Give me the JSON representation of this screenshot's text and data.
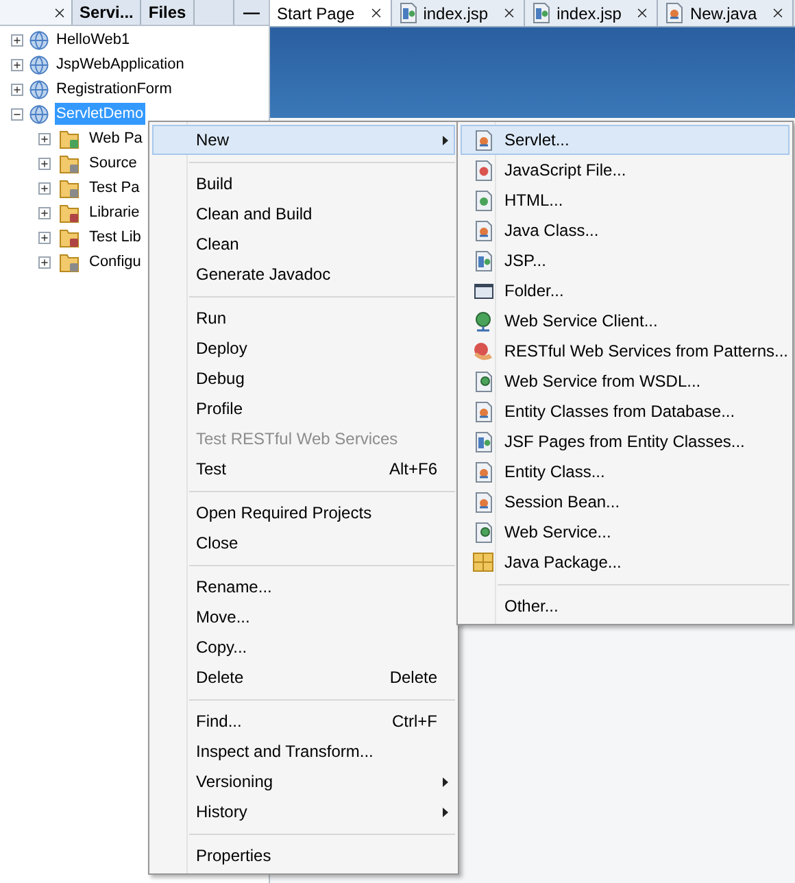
{
  "panel_tabs": [
    {
      "kind": "close_only",
      "selected": true
    },
    {
      "kind": "label",
      "label": "Servi...",
      "selected": false
    },
    {
      "kind": "label",
      "label": "Files",
      "selected": false
    }
  ],
  "panel_minimize": "—",
  "projects": [
    {
      "label": "HelloWeb1",
      "expanded": false,
      "selected": false
    },
    {
      "label": "JspWebApplication",
      "expanded": false,
      "selected": false
    },
    {
      "label": "RegistrationForm",
      "expanded": false,
      "selected": false
    },
    {
      "label": "ServletDemo",
      "expanded": true,
      "selected": true,
      "children": [
        {
          "label": "Web Pa",
          "kind": "web"
        },
        {
          "label": "Source",
          "kind": "source"
        },
        {
          "label": "Test Pa",
          "kind": "source"
        },
        {
          "label": "Librarie",
          "kind": "library"
        },
        {
          "label": "Test Lib",
          "kind": "library"
        },
        {
          "label": "Configu",
          "kind": "config"
        }
      ]
    }
  ],
  "editor_tabs": [
    {
      "label": "Start Page",
      "kind": "plain",
      "selected": true
    },
    {
      "label": "index.jsp",
      "kind": "jsp",
      "selected": false
    },
    {
      "label": "index.jsp",
      "kind": "jsp",
      "selected": false
    },
    {
      "label": "New.java",
      "kind": "java",
      "selected": false
    }
  ],
  "context_menu": [
    {
      "kind": "item",
      "label": "New",
      "submenu": true,
      "selected": true,
      "disabled": false
    },
    {
      "kind": "separator"
    },
    {
      "kind": "item",
      "label": "Build",
      "submenu": false,
      "selected": false,
      "disabled": false
    },
    {
      "kind": "item",
      "label": "Clean and Build",
      "submenu": false,
      "selected": false,
      "disabled": false
    },
    {
      "kind": "item",
      "label": "Clean",
      "submenu": false,
      "selected": false,
      "disabled": false
    },
    {
      "kind": "item",
      "label": "Generate Javadoc",
      "submenu": false,
      "selected": false,
      "disabled": false
    },
    {
      "kind": "separator"
    },
    {
      "kind": "item",
      "label": "Run",
      "submenu": false,
      "selected": false,
      "disabled": false
    },
    {
      "kind": "item",
      "label": "Deploy",
      "submenu": false,
      "selected": false,
      "disabled": false
    },
    {
      "kind": "item",
      "label": "Debug",
      "submenu": false,
      "selected": false,
      "disabled": false
    },
    {
      "kind": "item",
      "label": "Profile",
      "submenu": false,
      "selected": false,
      "disabled": false
    },
    {
      "kind": "item",
      "label": "Test RESTful Web Services",
      "submenu": false,
      "selected": false,
      "disabled": true
    },
    {
      "kind": "item",
      "label": "Test",
      "shortcut": "Alt+F6",
      "submenu": false,
      "selected": false,
      "disabled": false
    },
    {
      "kind": "separator"
    },
    {
      "kind": "item",
      "label": "Open Required Projects",
      "submenu": false,
      "selected": false,
      "disabled": false
    },
    {
      "kind": "item",
      "label": "Close",
      "submenu": false,
      "selected": false,
      "disabled": false
    },
    {
      "kind": "separator"
    },
    {
      "kind": "item",
      "label": "Rename...",
      "submenu": false,
      "selected": false,
      "disabled": false
    },
    {
      "kind": "item",
      "label": "Move...",
      "submenu": false,
      "selected": false,
      "disabled": false
    },
    {
      "kind": "item",
      "label": "Copy...",
      "submenu": false,
      "selected": false,
      "disabled": false
    },
    {
      "kind": "item",
      "label": "Delete",
      "shortcut": "Delete",
      "submenu": false,
      "selected": false,
      "disabled": false
    },
    {
      "kind": "separator"
    },
    {
      "kind": "item",
      "label": "Find...",
      "shortcut": "Ctrl+F",
      "submenu": false,
      "selected": false,
      "disabled": false
    },
    {
      "kind": "item",
      "label": "Inspect and Transform...",
      "submenu": false,
      "selected": false,
      "disabled": false
    },
    {
      "kind": "item",
      "label": "Versioning",
      "submenu": true,
      "selected": false,
      "disabled": false
    },
    {
      "kind": "item",
      "label": "History",
      "submenu": true,
      "selected": false,
      "disabled": false
    },
    {
      "kind": "separator"
    },
    {
      "kind": "item",
      "label": "Properties",
      "submenu": false,
      "selected": false,
      "disabled": false
    }
  ],
  "new_submenu": [
    {
      "kind": "java",
      "label": "Servlet...",
      "selected": true
    },
    {
      "kind": "javascript",
      "label": "JavaScript File...",
      "selected": false
    },
    {
      "kind": "html",
      "label": "HTML...",
      "selected": false
    },
    {
      "kind": "java",
      "label": "Java Class...",
      "selected": false
    },
    {
      "kind": "jsp",
      "label": "JSP...",
      "selected": false
    },
    {
      "kind": "folder",
      "label": "Folder...",
      "selected": false
    },
    {
      "kind": "ws_client",
      "label": "Web Service Client...",
      "selected": false
    },
    {
      "kind": "rest",
      "label": "RESTful Web Services from Patterns...",
      "selected": false
    },
    {
      "kind": "ws",
      "label": "Web Service from WSDL...",
      "selected": false
    },
    {
      "kind": "java",
      "label": "Entity Classes from Database...",
      "selected": false
    },
    {
      "kind": "jsp",
      "label": "JSF Pages from Entity Classes...",
      "selected": false
    },
    {
      "kind": "java",
      "label": "Entity Class...",
      "selected": false
    },
    {
      "kind": "java",
      "label": "Session Bean...",
      "selected": false
    },
    {
      "kind": "ws",
      "label": "Web Service...",
      "selected": false
    },
    {
      "kind": "package",
      "label": "Java Package...",
      "selected": false
    },
    {
      "kind": "separator"
    },
    {
      "kind": "other",
      "label": "Other...",
      "selected": false
    }
  ]
}
